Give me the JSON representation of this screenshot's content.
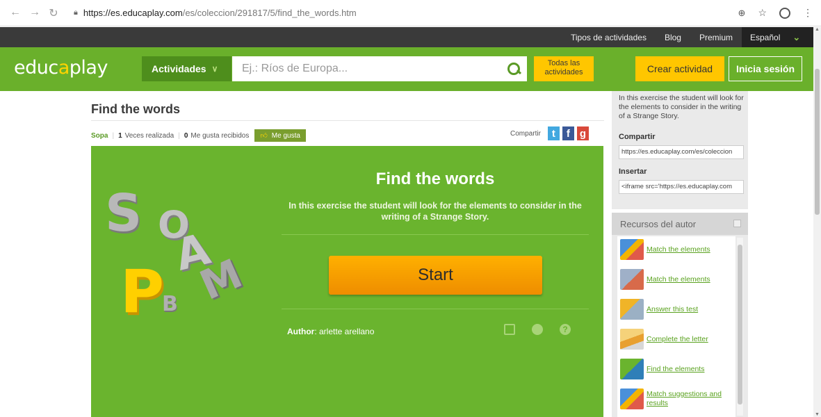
{
  "browser": {
    "url_host": "https://es.educaplay.com",
    "url_path": "/es/coleccion/291817/5/find_the_words.htm"
  },
  "topbar": {
    "links": [
      "Tipos de actividades",
      "Blog",
      "Premium"
    ],
    "language": "Español"
  },
  "header": {
    "logo_main": "educ",
    "logo_accent": "a",
    "logo_rest": "play",
    "activities_label": "Actividades",
    "search_placeholder": "Ej.: Ríos de Europa...",
    "all_activities_line1": "Todas las",
    "all_activities_line2": "actividades",
    "create_label": "Crear actividad",
    "login_label": "Inicia sesión"
  },
  "activity": {
    "title": "Find the words",
    "type": "Sopa",
    "times_done": "1",
    "times_done_label": "Veces realizada",
    "likes": "0",
    "likes_label": "Me gusta recibidos",
    "like_button": "Me gusta",
    "share_label": "Compartir"
  },
  "game": {
    "title": "Find the words",
    "description": "In this exercise the student will look for the elements to consider in the writing of a Strange Story.",
    "start_label": "Start",
    "author_label": "Author",
    "author_name": ": arlette arellano",
    "letters": [
      "S",
      "O",
      "P",
      "B",
      "A",
      "M"
    ]
  },
  "sidebar": {
    "description": "In this exercise the student will look for the elements to consider in the writing of a Strange Story.",
    "share_label": "Compartir",
    "share_url": "https://es.educaplay.com/es/coleccion",
    "embed_label": "Insertar",
    "embed_code": "<iframe src='https://es.educaplay.com"
  },
  "resources": {
    "title": "Recursos del autor",
    "items": [
      {
        "label": "Match the elements",
        "color": "#4a90d9"
      },
      {
        "label": "Match the elements",
        "color": "#9fb0c8"
      },
      {
        "label": "Answer this test",
        "color": "#f0b428"
      },
      {
        "label": "Complete the letter",
        "color": "#e8a030"
      },
      {
        "label": "Find the elements",
        "color": "#6ab42e"
      },
      {
        "label": "Match suggestions and results",
        "color": "#4a90d9"
      }
    ]
  },
  "colors": {
    "brand_green": "#6ab02b",
    "accent_yellow": "#ffc600",
    "start_orange": "#f5a000",
    "dark_bar": "#3a3a3a"
  }
}
